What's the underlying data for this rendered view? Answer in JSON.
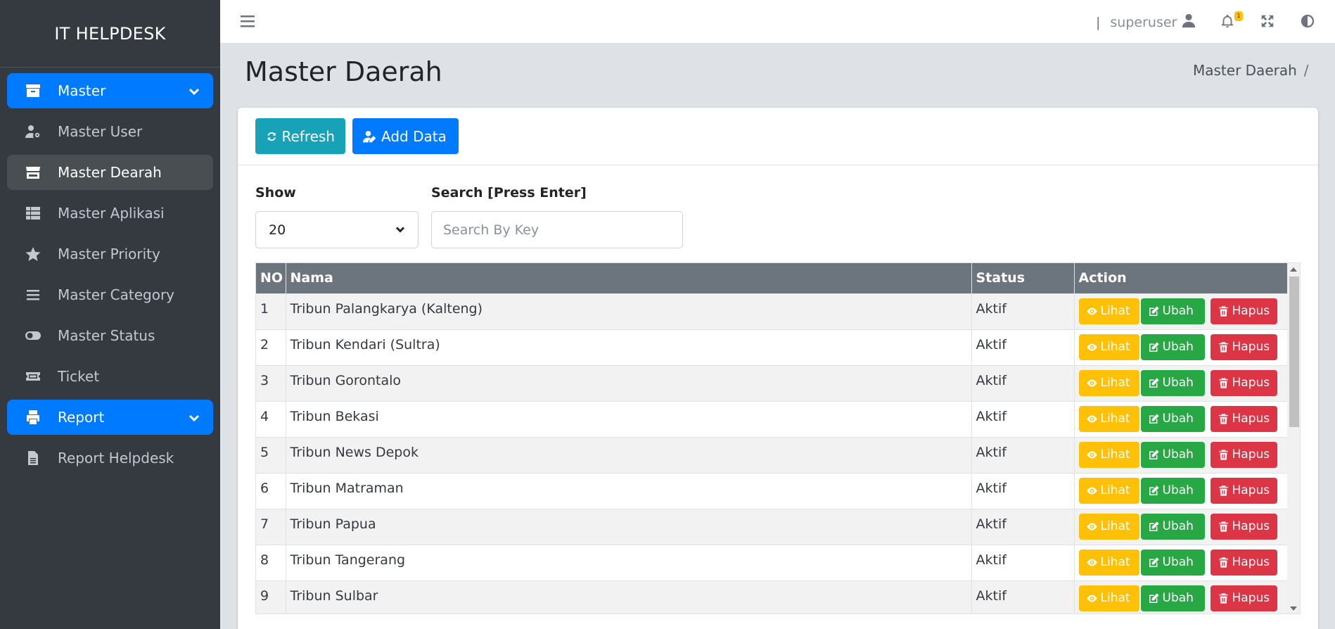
{
  "brand": "IT HELPDESK",
  "sidebar": {
    "items": [
      {
        "label": "Master",
        "icon": "archive-icon"
      },
      {
        "label": "Master User",
        "icon": "user-gear-icon"
      },
      {
        "label": "Master Dearah",
        "icon": "store-icon"
      },
      {
        "label": "Master Aplikasi",
        "icon": "table-icon"
      },
      {
        "label": "Master Priority",
        "icon": "star-icon"
      },
      {
        "label": "Master Category",
        "icon": "bars-icon"
      },
      {
        "label": "Master Status",
        "icon": "toggle-icon"
      },
      {
        "label": "Ticket",
        "icon": "ticket-icon"
      },
      {
        "label": "Report",
        "icon": "print-icon"
      },
      {
        "label": "Report Helpdesk",
        "icon": "file-icon"
      }
    ]
  },
  "topbar": {
    "separator": "|",
    "username": "superuser",
    "notification_count": "1"
  },
  "page": {
    "title": "Master Daerah",
    "breadcrumb": "Master Daerah",
    "breadcrumb_sep": "/"
  },
  "toolbar": {
    "refresh_label": "Refresh",
    "add_label": "Add Data"
  },
  "filters": {
    "show_label": "Show",
    "show_value": "20",
    "search_label": "Search [Press Enter]",
    "search_placeholder": "Search By Key",
    "search_value": ""
  },
  "table": {
    "headers": [
      "NO",
      "Nama",
      "Status",
      "Action"
    ],
    "rows": [
      {
        "no": "1",
        "nama": "Tribun Palangkarya (Kalteng)",
        "status": "Aktif"
      },
      {
        "no": "2",
        "nama": "Tribun Kendari (Sultra)",
        "status": "Aktif"
      },
      {
        "no": "3",
        "nama": "Tribun Gorontalo",
        "status": "Aktif"
      },
      {
        "no": "4",
        "nama": "Tribun Bekasi",
        "status": "Aktif"
      },
      {
        "no": "5",
        "nama": "Tribun News Depok",
        "status": "Aktif"
      },
      {
        "no": "6",
        "nama": "Tribun Matraman",
        "status": "Aktif"
      },
      {
        "no": "7",
        "nama": "Tribun Papua",
        "status": "Aktif"
      },
      {
        "no": "8",
        "nama": "Tribun Tangerang",
        "status": "Aktif"
      },
      {
        "no": "9",
        "nama": "Tribun Sulbar",
        "status": "Aktif"
      }
    ],
    "actions": {
      "view": "Lihat",
      "edit": "Ubah",
      "delete": "Hapus"
    }
  },
  "colors": {
    "sidebar_bg": "#343a40",
    "primary": "#007bff",
    "info": "#17a2b8",
    "warning": "#ffc107",
    "success": "#28a745",
    "danger": "#dc3545",
    "table_header": "#6c757d"
  }
}
